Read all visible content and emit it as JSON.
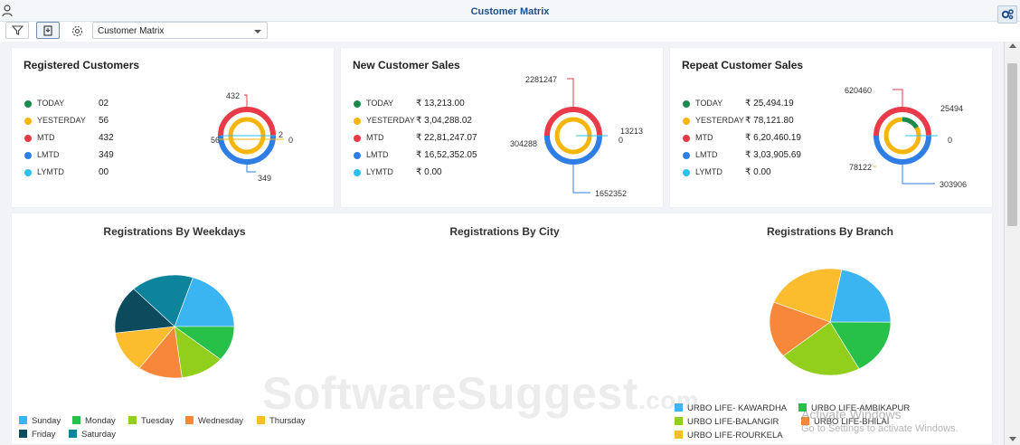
{
  "window": {
    "title": "Customer Matrix"
  },
  "toolbar": {
    "selected_view": "Customer Matrix"
  },
  "icons": {
    "user": "user-icon",
    "cog": "cogs-icon",
    "filter": "filter-icon",
    "export": "export-icon",
    "settings": "gear-icon"
  },
  "colors": {
    "today": "#1a8a4f",
    "yesterday": "#f5b50a",
    "mtd": "#e83a48",
    "lmtd": "#2e7ee6",
    "lymtd": "#2ec0ea",
    "title": "#1f4e8c"
  },
  "cards": [
    {
      "title": "Registered Customers",
      "rows": [
        {
          "label": "TODAY",
          "value": "02"
        },
        {
          "label": "YESTERDAY",
          "value": "56"
        },
        {
          "label": "MTD",
          "value": "432"
        },
        {
          "label": "LMTD",
          "value": "349"
        },
        {
          "label": "LYMTD",
          "value": "00"
        }
      ],
      "annotations": [
        "432",
        "56",
        "2",
        "0",
        "349"
      ]
    },
    {
      "title": "New Customer Sales",
      "rows": [
        {
          "label": "TODAY",
          "value": "₹ 13,213.00"
        },
        {
          "label": "YESTERDAY",
          "value": "₹ 3,04,288.02"
        },
        {
          "label": "MTD",
          "value": "₹ 22,81,247.07"
        },
        {
          "label": "LMTD",
          "value": "₹ 16,52,352.05"
        },
        {
          "label": "LYMTD",
          "value": "₹ 0.00"
        }
      ],
      "annotations": [
        "2281247",
        "13213",
        "0",
        "304288",
        "1652352"
      ]
    },
    {
      "title": "Repeat Customer Sales",
      "rows": [
        {
          "label": "TODAY",
          "value": "₹ 25,494.19"
        },
        {
          "label": "YESTERDAY",
          "value": "₹ 78,121.80"
        },
        {
          "label": "MTD",
          "value": "₹ 6,20,460.19"
        },
        {
          "label": "LMTD",
          "value": "₹ 3,03,905.69"
        },
        {
          "label": "LYMTD",
          "value": "₹ 0.00"
        }
      ],
      "annotations": [
        "620460",
        "25494",
        "0",
        "78122",
        "303906"
      ]
    }
  ],
  "sections": {
    "weekdays": "Registrations By Weekdays",
    "city": "Registrations By City",
    "branch": "Registrations By Branch"
  },
  "chart_data": [
    {
      "type": "pie",
      "title": "Registrations By Weekdays",
      "series": [
        {
          "name": "Sunday",
          "value": 20,
          "color": "#3bb4f2"
        },
        {
          "name": "Monday",
          "value": 11,
          "color": "#27c14a"
        },
        {
          "name": "Tuesday",
          "value": 12,
          "color": "#92cf1d"
        },
        {
          "name": "Wednesday",
          "value": 12,
          "color": "#f7883b"
        },
        {
          "name": "Thursday",
          "value": 13,
          "color": "#fbbd2e"
        },
        {
          "name": "Friday",
          "value": 15,
          "color": "#0c4a5e"
        },
        {
          "name": "Saturday",
          "value": 17,
          "color": "#0d849c"
        }
      ]
    },
    {
      "type": "pie",
      "title": "Registrations By Branch",
      "series": [
        {
          "name": "URBO LIFE- KAWARDHA",
          "value": 22,
          "color": "#3bb4f2"
        },
        {
          "name": "URBO LIFE-AMBIKAPUR",
          "value": 17,
          "color": "#27c14a"
        },
        {
          "name": "URBO LIFE-BALANGIR",
          "value": 22,
          "color": "#92cf1d"
        },
        {
          "name": "URBO LIFE-BHILAI",
          "value": 17,
          "color": "#f7883b"
        },
        {
          "name": "URBO LIFE-ROURKELA",
          "value": 22,
          "color": "#fbbd2e"
        }
      ]
    }
  ],
  "overlay": {
    "watermark": "SoftwareSuggest",
    "watermark_suffix": ".com",
    "activate_line1": "Activate Windows",
    "activate_line2": "Go to Settings to activate Windows."
  }
}
